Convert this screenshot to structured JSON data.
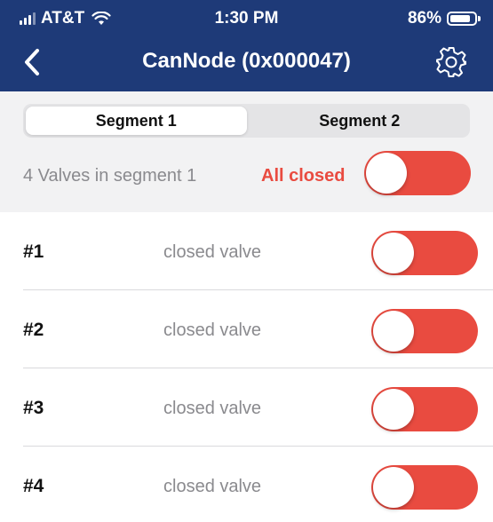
{
  "status_bar": {
    "carrier": "AT&T",
    "time": "1:30 PM",
    "battery_percent": "86%",
    "battery_level": 0.86,
    "icons": [
      "signal-icon",
      "wifi-icon",
      "battery-icon"
    ]
  },
  "nav": {
    "title": "CanNode (0x000047)",
    "back_icon": "chevron-left-icon",
    "settings_icon": "gear-icon"
  },
  "segments": {
    "items": [
      {
        "label": "Segment 1",
        "selected": true
      },
      {
        "label": "Segment 2",
        "selected": false
      }
    ]
  },
  "summary": {
    "count_text": "4 Valves in segment 1",
    "state_text": "All closed",
    "toggle_on": true
  },
  "valves": [
    {
      "label": "#1",
      "state": "closed valve",
      "toggle_on": true
    },
    {
      "label": "#2",
      "state": "closed valve",
      "toggle_on": true
    },
    {
      "label": "#3",
      "state": "closed valve",
      "toggle_on": true
    },
    {
      "label": "#4",
      "state": "closed valve",
      "toggle_on": true
    }
  ],
  "colors": {
    "header": "#1e3a78",
    "accent_red": "#e94b40",
    "muted_text": "#8a8a8e",
    "panel": "#f2f2f3"
  }
}
